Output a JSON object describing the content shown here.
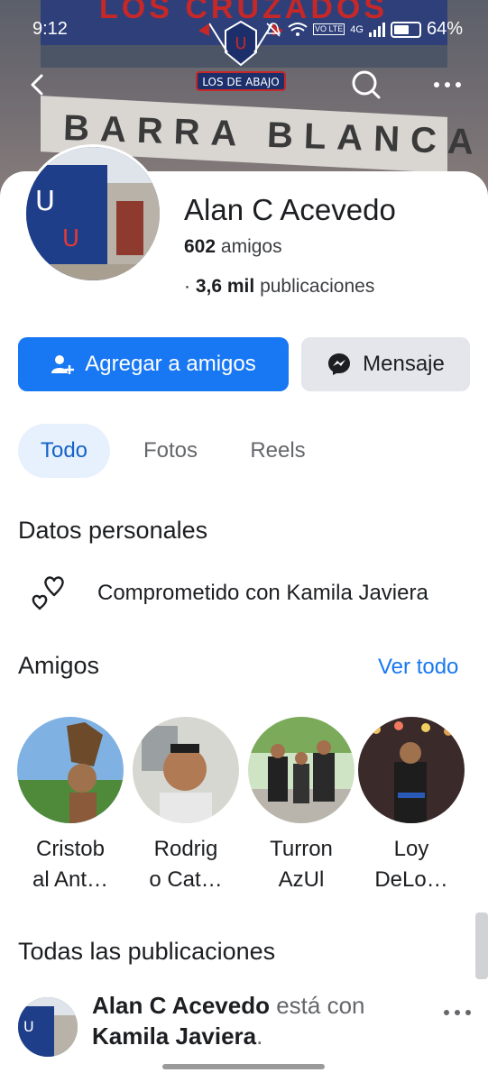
{
  "status_bar": {
    "time": "9:12",
    "net_label": "4G",
    "volte_label": "VO LTE",
    "battery": "64%"
  },
  "cover": {
    "banner_top_text": "LOS CRUZADOS",
    "banner_text": "BARRA BLANCA",
    "logo_text": "LOS DE ABAJO"
  },
  "profile": {
    "name": "Alan C Acevedo",
    "friends_count": "602",
    "friends_label": "amigos",
    "posts_count": "3,6 mil",
    "posts_label": "publicaciones",
    "bullet": "·"
  },
  "actions": {
    "add_friend": "Agregar a amigos",
    "message": "Mensaje"
  },
  "tabs": [
    {
      "label": "Todo",
      "active": true
    },
    {
      "label": "Fotos",
      "active": false
    },
    {
      "label": "Reels",
      "active": false
    }
  ],
  "personal": {
    "title": "Datos personales",
    "relationship": "Comprometido con Kamila Javiera",
    "icon": "hearts-icon"
  },
  "friends": {
    "title": "Amigos",
    "see_all": "Ver todo",
    "items": [
      {
        "line1": "Cristob",
        "line2": "al Ant…"
      },
      {
        "line1": "Rodrig",
        "line2": "o Cat…"
      },
      {
        "line1": "Turron",
        "line2": "AzUl"
      },
      {
        "line1": "Loy",
        "line2": "DeLo…"
      }
    ]
  },
  "posts": {
    "title": "Todas las publicaciones",
    "author": "Alan C Acevedo",
    "with_text": "está con",
    "tagged": "Kamila Javiera",
    "period": "."
  },
  "colors": {
    "accent": "#1877f2",
    "tab_active_bg": "#e7f0fd",
    "secondary_btn": "#e4e6eb"
  }
}
